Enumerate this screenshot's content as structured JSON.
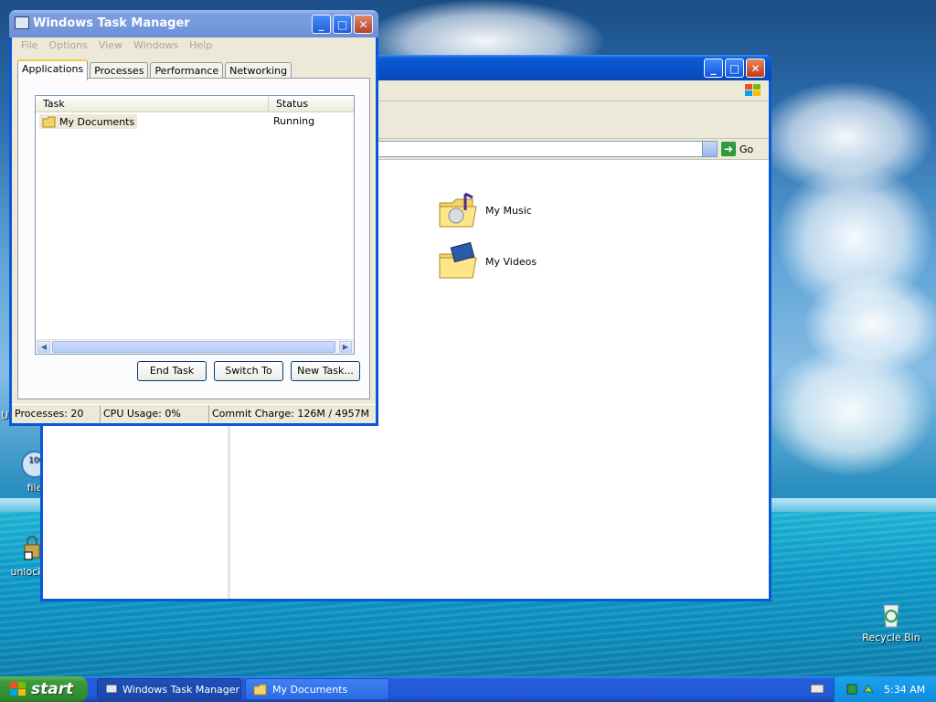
{
  "desktop": {
    "icons": [
      {
        "label": "Ultra Pro"
      },
      {
        "label": "file"
      },
      {
        "label": "unlocker"
      },
      {
        "label": "Recycle Bin"
      }
    ]
  },
  "explorer": {
    "go_label": "Go",
    "items": [
      {
        "label": "My Music",
        "icon": "music-folder-icon"
      },
      {
        "label": "My Videos",
        "icon": "video-folder-icon"
      }
    ]
  },
  "taskmgr": {
    "title": "Windows Task Manager",
    "menu": [
      "File",
      "Options",
      "View",
      "Windows",
      "Help"
    ],
    "tabs": [
      "Applications",
      "Processes",
      "Performance",
      "Networking"
    ],
    "columns": {
      "task": "Task",
      "status": "Status"
    },
    "rows": [
      {
        "task": "My Documents",
        "status": "Running"
      }
    ],
    "buttons": {
      "end_task": "End Task",
      "switch_to": "Switch To",
      "new_task": "New Task..."
    },
    "status": {
      "processes": "Processes: 20",
      "cpu": "CPU Usage: 0%",
      "commit": "Commit Charge: 126M / 4957M"
    }
  },
  "taskbar": {
    "start_label": "start",
    "buttons": [
      {
        "label": "Windows Task Manager"
      },
      {
        "label": "My Documents"
      }
    ],
    "clock": "5:34 AM"
  }
}
